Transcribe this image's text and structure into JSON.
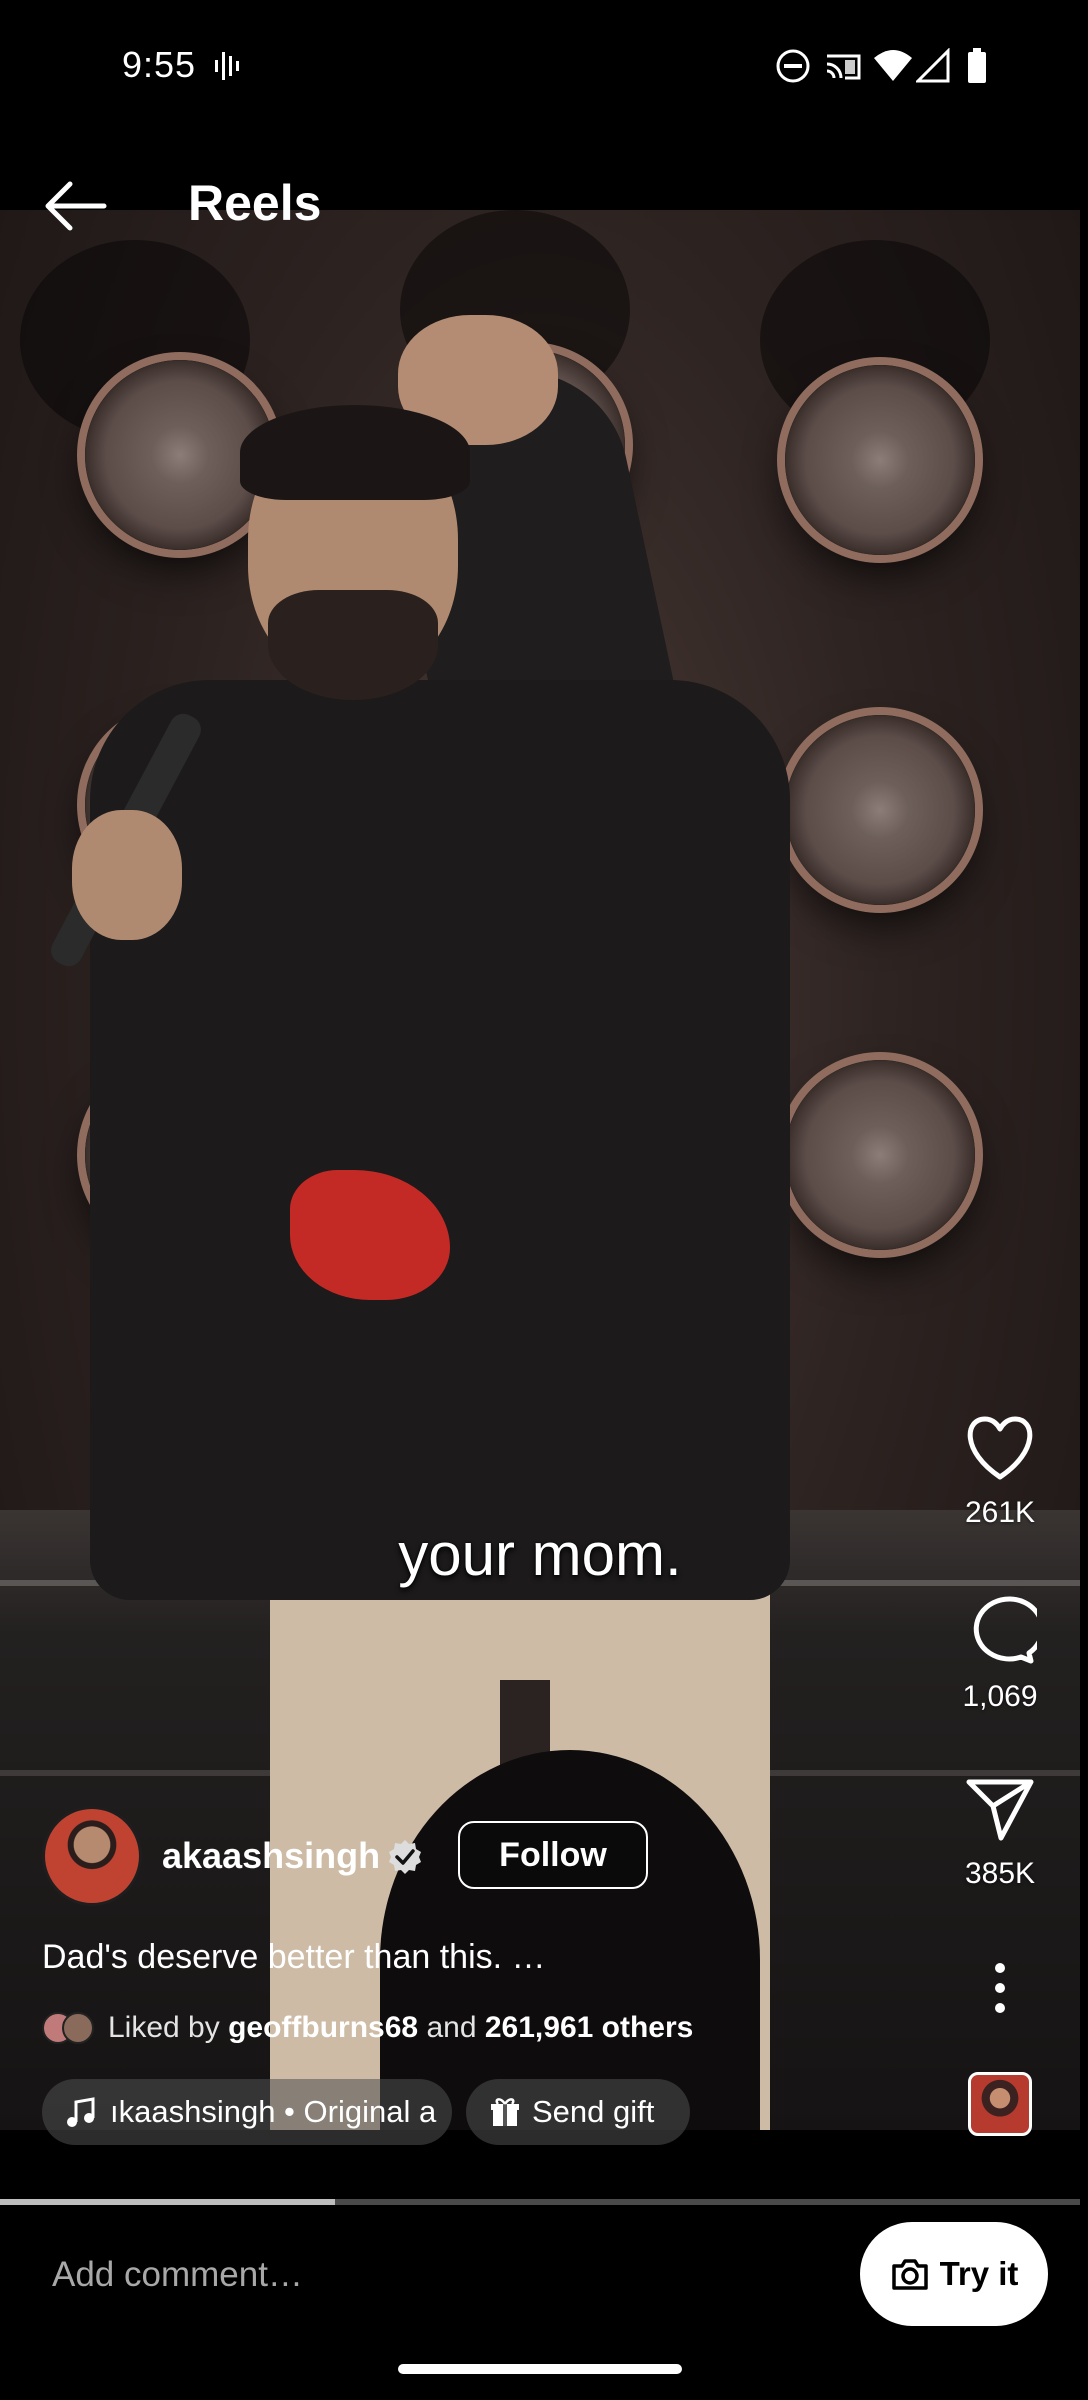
{
  "status_bar": {
    "time": "9:55",
    "icons": [
      "voice-icon",
      "do-not-disturb-icon",
      "cast-icon",
      "wifi-icon",
      "signal-icon",
      "battery-icon"
    ]
  },
  "header": {
    "title": "Reels",
    "back_icon": "arrow-left-icon"
  },
  "video": {
    "caption": "your mom."
  },
  "actions": {
    "like_count": "261K",
    "comment_count": "1,069",
    "share_count": "385K"
  },
  "author": {
    "username": "akaashsingh",
    "follow_label": "Follow"
  },
  "post": {
    "description": "Dad's deserve better than this. …",
    "liked_prefix": "Liked by",
    "liked_user": "geoffburns68",
    "liked_and": "and",
    "liked_others": "261,961 others"
  },
  "chips": {
    "audio_label": "ıkaashsingh • Original a",
    "gift_label": "Send gift"
  },
  "playback": {
    "progress": 0.31
  },
  "comment": {
    "placeholder": "Add comment…",
    "try_label": "Try it"
  },
  "colors": {
    "background": "#000000",
    "accent": "#ffffff"
  }
}
